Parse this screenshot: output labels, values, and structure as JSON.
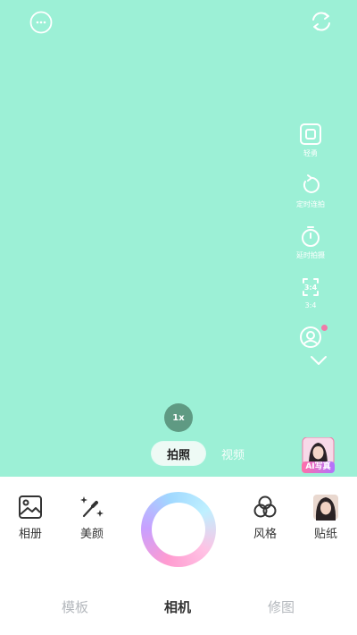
{
  "colors": {
    "viewfinder_bg": "#9cf0d6",
    "accent_pink": "#f07aa8",
    "inactive_tab": "#b4b8bd"
  },
  "top": {
    "left_icon": "live-photo-icon",
    "right_icon": "switch-camera-icon"
  },
  "tools": [
    {
      "id": "exposure",
      "label": "轻勇",
      "icon": "square-frame-icon"
    },
    {
      "id": "continuous",
      "label": "定时连拍",
      "icon": "timer-loop-icon"
    },
    {
      "id": "timer",
      "label": "延时拍摄",
      "icon": "stopwatch-icon"
    },
    {
      "id": "ratio",
      "label": "3:4",
      "icon": "aspect-ratio-icon",
      "icon_text": "3:4"
    },
    {
      "id": "portrait",
      "label": "",
      "icon": "portrait-icon",
      "badge": true
    }
  ],
  "zoom": {
    "label": "1x"
  },
  "modes": {
    "photo": "拍照",
    "video": "视频"
  },
  "ai_portrait": {
    "label": "AI写真"
  },
  "bottom": {
    "album": "相册",
    "beauty": "美颜",
    "style": "风格",
    "sticker": "贴纸"
  },
  "tabs": [
    {
      "label": "模板"
    },
    {
      "label": "相机",
      "active": true
    },
    {
      "label": "修图"
    }
  ]
}
